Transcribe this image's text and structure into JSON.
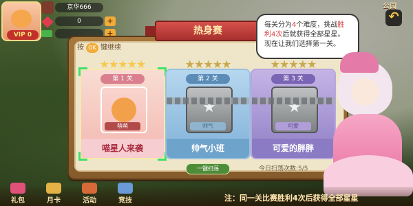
{
  "player": {
    "name": "京华666",
    "vip": "VIP 0",
    "gems": "0"
  },
  "top_right": {
    "gift_label": "公园",
    "back_icon": "back-arrow-icon"
  },
  "panel": {
    "title": "热身赛",
    "close": "×",
    "one_key_prefix": "按",
    "one_key_ok": "OK",
    "one_key_suffix": "键继续",
    "sweep_button": "一键扫荡",
    "sweep_count": "今日扫荡次数:5/5"
  },
  "levels": [
    {
      "badge": "第 1 关",
      "tag": "萌萌",
      "name": "喵星人来袭",
      "stars": "★★★★★",
      "locked": false
    },
    {
      "badge": "第 2 关",
      "tag": "帅气",
      "name": "帅气小班",
      "stars": "★★★★★",
      "locked": true
    },
    {
      "badge": "第 3 关",
      "tag": "可爱",
      "name": "可爱的胖胖",
      "stars": "★★★★★",
      "locked": true
    }
  ],
  "bubble": {
    "line1": "每关分为",
    "n4": "4",
    "line1b": "个难度，挑战",
    "win": "胜",
    "line2a": "利",
    "n4b": "4",
    "line2b": "次",
    "line2c": "后就获得全部星星。现在让我们选择第一关。"
  },
  "bottom_nav": [
    {
      "label": "礼包",
      "icon": "gift-icon"
    },
    {
      "label": "月卡",
      "icon": "card-icon"
    },
    {
      "label": "活动",
      "icon": "activity-icon"
    },
    {
      "label": "竞技",
      "icon": "compete-icon"
    }
  ],
  "note": "注：同一关比赛胜利4次后获得全部星星",
  "colors": {
    "accent": "#a8302e",
    "gold": "#f3ab3a",
    "green": "#3fe06b"
  }
}
